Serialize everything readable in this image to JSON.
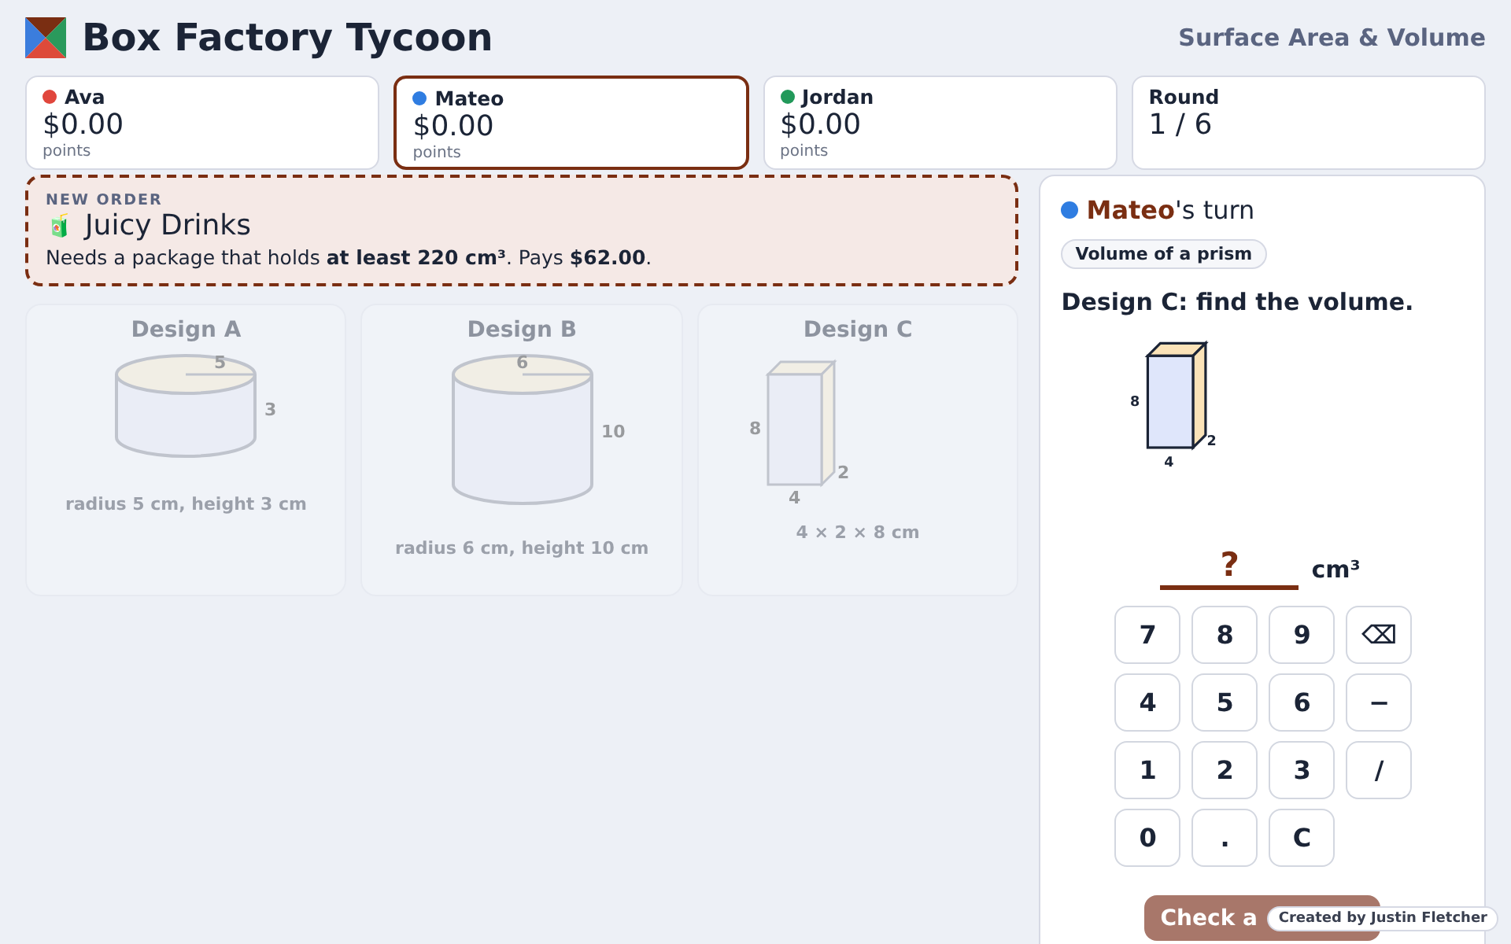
{
  "header": {
    "title": "Box Factory Tycoon",
    "subtitle": "Surface Area & Volume"
  },
  "scoreboard": [
    {
      "name": "Ava",
      "color": "#e0463c",
      "amount": "$0.00",
      "unit": "points",
      "selected": false
    },
    {
      "name": "Mateo",
      "color": "#2f7de1",
      "amount": "$0.00",
      "unit": "points",
      "selected": true
    },
    {
      "name": "Jordan",
      "color": "#22995a",
      "amount": "$0.00",
      "unit": "points",
      "selected": false
    }
  ],
  "round": {
    "label": "Round",
    "value": "1 / 6"
  },
  "order": {
    "tag": "NEW ORDER",
    "icon": "🧃",
    "title": "Juicy Drinks",
    "text": "Needs a package that holds **at least 220 cm³**. Pays **$62.00**."
  },
  "designs": [
    {
      "title": "Design A",
      "kind": "cylinder",
      "labels": [
        "5",
        "3"
      ],
      "caption": "radius 5 cm, height 3 cm",
      "disabled": true
    },
    {
      "title": "Design B",
      "kind": "cylinder_tall",
      "labels": [
        "6",
        "10"
      ],
      "caption": "radius 6 cm, height 10 cm",
      "disabled": true
    },
    {
      "title": "Design C",
      "kind": "prism",
      "labels": [
        "8",
        "2",
        "4"
      ],
      "caption": "4 × 2 × 8 cm",
      "disabled": true
    }
  ],
  "turn": {
    "player": "Mateo",
    "color": "#2f7de1",
    "suffix": "'s turn",
    "topic": "Volume of a prism",
    "question": "Design C: find the volume.",
    "figure_labels": [
      "8",
      "2",
      "4"
    ],
    "answer_placeholder": "?",
    "unit": "cm³"
  },
  "keypad": [
    "7",
    "8",
    "9",
    "⌫",
    "4",
    "5",
    "6",
    "−",
    "1",
    "2",
    "3",
    "/",
    "0",
    ".",
    "C"
  ],
  "check_button": "Check a",
  "credit": "Created by Justin Fletcher"
}
